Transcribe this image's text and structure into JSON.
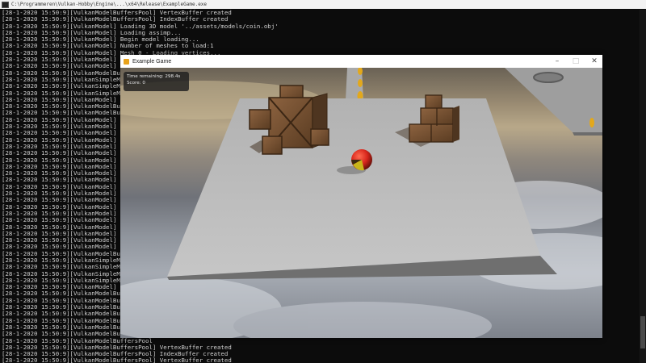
{
  "console": {
    "title": "C:\\Programmeren\\Vulkan-Hobby\\Engine\\...\\x64\\Release\\ExampleGame.exe",
    "lines": [
      "[28-1-2020 15:50:9][VulkanModelBuffersPool] VertexBuffer created",
      "[28-1-2020 15:50:9][VulkanModelBuffersPool] IndexBuffer created",
      "[28-1-2020 15:50:9][VulkanModel] Loading 3D model '../assets/models/coin.obj'",
      "[28-1-2020 15:50:9][VulkanModel] Loading assimp...",
      "[28-1-2020 15:50:9][VulkanModel] Begin model loading...",
      "[28-1-2020 15:50:9][VulkanModel] Number of meshes to load:1",
      "[28-1-2020 15:50:9][VulkanModel] Mesh 0 - Loading vertices...",
      "[28-1-2020 15:50:9][VulkanModel] Mesh 0 - Loading indices...",
      "[28-1-2020 15:50:9][VulkanModel] Vertex",
      "[28-1-2020 15:50:9][VulkanModelBuffersPool] Mod",
      "[28-1-2020 15:50:9][VulkanSimpleMaterial",
      "[28-1-2020 15:50:9][VulkanSimpleMaterial",
      "[28-1-2020 15:50:9][VulkanSimpleMaterial",
      "[28-1-2020 15:50:9][VulkanModel] Loading '../assets/mo",
      "[28-1-2020 15:50:9][VulkanModelBuffersPool",
      "[28-1-2020 15:50:9][VulkanModelBuffersPool",
      "[28-1-2020 15:50:9][VulkanModel] Loading",
      "[28-1-2020 15:50:9][VulkanModel] Begin m",
      "[28-1-2020 15:50:9][VulkanModel] Number",
      "[28-1-2020 15:50:9][VulkanModel] Mesh 0",
      "[28-1-2020 15:50:9][VulkanModel] Mesh 0",
      "[28-1-2020 15:50:9][VulkanModel] Mesh 1",
      "[28-1-2020 15:50:9][VulkanModel] Mesh 1",
      "[28-1-2020 15:50:9][VulkanModel] Mesh 2",
      "[28-1-2020 15:50:9][VulkanModel] Mesh 2",
      "[28-1-2020 15:50:9][VulkanModel] Mesh 3",
      "[28-1-2020 15:50:9][VulkanModel] Mesh 3",
      "[28-1-2020 15:50:9][VulkanModel] Mesh 4",
      "[28-1-2020 15:50:9][VulkanModel] Mesh 4",
      "[28-1-2020 15:50:9][VulkanModel] Mesh 5",
      "[28-1-2020 15:50:9][VulkanModel] Mesh 5",
      "[28-1-2020 15:50:9][VulkanModel] Mesh 6",
      "[28-1-2020 15:50:9][VulkanModel] Mesh 6",
      "[28-1-2020 15:50:9][VulkanModel] Mesh 7",
      "[28-1-2020 15:50:9][VulkanModel] Mesh 7",
      "[28-1-2020 15:50:9][VulkanModel] Vertex",
      "[28-1-2020 15:50:9][VulkanModelBuffersPool] Mod",
      "[28-1-2020 15:50:9][VulkanSimpleMaterial",
      "[28-1-2020 15:50:9][VulkanSimpleMaterial",
      "[28-1-2020 15:50:9][VulkanSimpleMaterial",
      "[28-1-2020 15:50:9][VulkanSimpleMaterial",
      "[28-1-2020 15:50:9][VulkanModel] Loading '../assets/mo",
      "[28-1-2020 15:50:9][VulkanModelBuffersPool",
      "[28-1-2020 15:50:9][VulkanModelBuffersPool",
      "[28-1-2020 15:50:9][VulkanModelBuffersPool",
      "[28-1-2020 15:50:9][VulkanModelBuffersPool",
      "[28-1-2020 15:50:9][VulkanModelBuffersPool",
      "[28-1-2020 15:50:9][VulkanModelBuffersPool",
      "[28-1-2020 15:50:9][VulkanModelBuffersPool",
      "[28-1-2020 15:50:9][VulkanModelBuffersPool",
      "[28-1-2020 15:50:9][VulkanModelBuffersPool] VertexBuffer created",
      "[28-1-2020 15:50:9][VulkanModelBuffersPool] IndexBuffer created",
      "[28-1-2020 15:50:9][VulkanModelBuffersPool] VertexBuffer created",
      "[28-1-2020 15:50:9][VulkanModelBuffersPool] IndexBuffer created"
    ]
  },
  "game": {
    "title": "Example Game",
    "hud": {
      "time_label": "Time remaining: 298.4s",
      "score_label": "Score: 0"
    },
    "colors": {
      "floor": "#b7b7b7",
      "ball_red": "#d8261c",
      "ball_yellow": "#c9b51a",
      "crate": "#7a5534",
      "coin": "#e3a81b"
    }
  },
  "window_controls": {
    "minimize_icon": "minimize-icon",
    "maximize_icon": "maximize-icon",
    "close_icon": "close-icon"
  }
}
